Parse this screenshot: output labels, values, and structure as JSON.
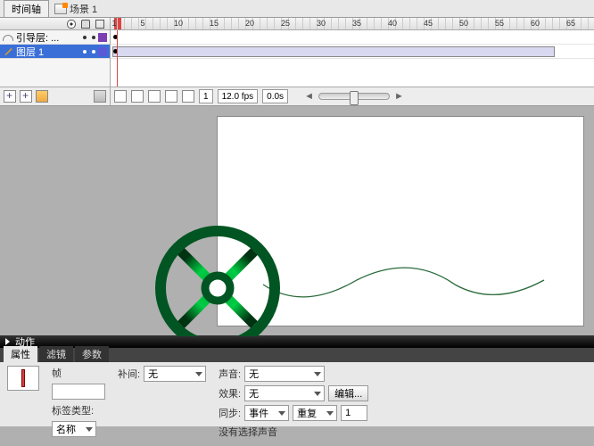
{
  "tabs": {
    "timeline": "时间轴",
    "scene": "场景 1"
  },
  "ruler": {
    "start": 1,
    "step": 5,
    "max": 105
  },
  "layers": [
    {
      "name": "引导层: ...",
      "color": "#7b3fb3",
      "selected": false,
      "type": "guide"
    },
    {
      "name": "图层 1",
      "color": "#5a5ad8",
      "selected": true,
      "type": "normal"
    }
  ],
  "timeline_footer": {
    "frame": "1",
    "fps": "12.0 fps",
    "time": "0.0s"
  },
  "actions": {
    "label": "动作"
  },
  "prop_tabs": {
    "properties": "属性",
    "filters": "滤镜",
    "params": "参数"
  },
  "props": {
    "frame_label": "帧",
    "label_type": "标签类型:",
    "label_type_value": "名称",
    "tween": "补间:",
    "tween_value": "无",
    "sound": "声音:",
    "sound_value": "无",
    "effect": "效果:",
    "effect_value": "无",
    "edit_btn": "编辑...",
    "sync": "同步:",
    "sync_value": "事件",
    "repeat_value": "重复",
    "repeat_count": "1",
    "no_sound": "没有选择声音"
  },
  "icons": {}
}
